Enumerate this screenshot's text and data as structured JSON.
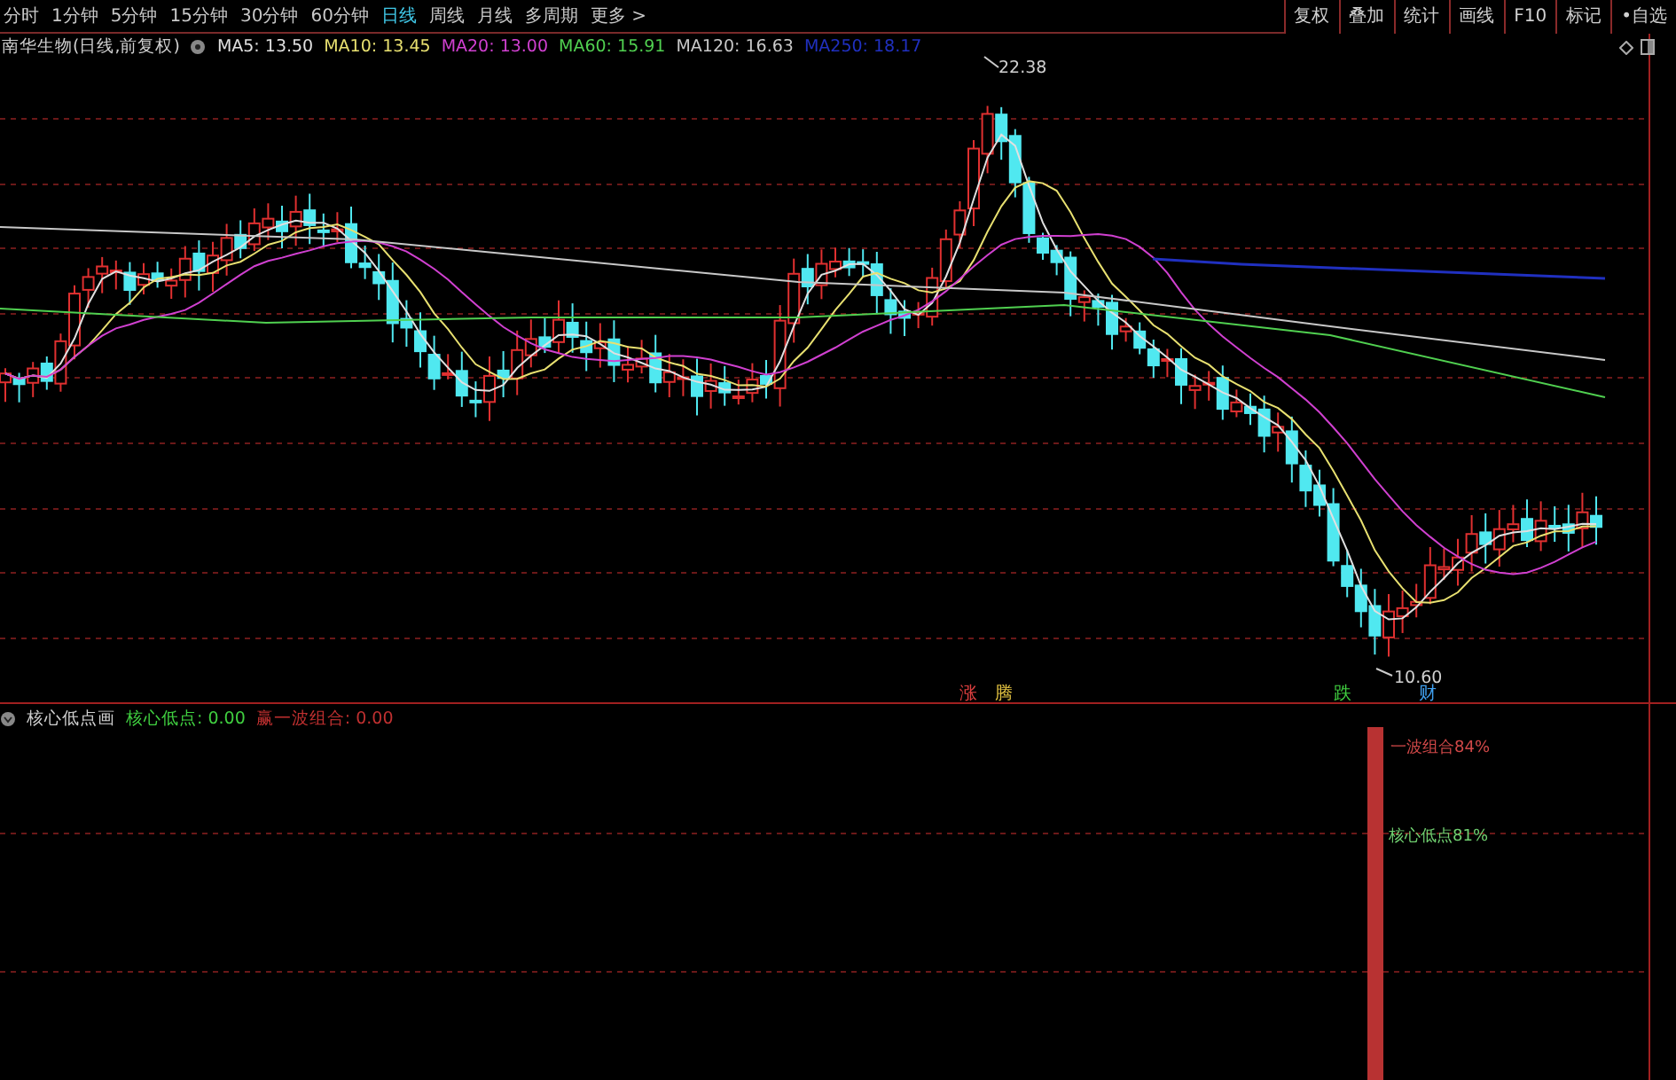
{
  "toolbar": {
    "periods": [
      {
        "label": "分时",
        "selected": false
      },
      {
        "label": "1分钟",
        "selected": false
      },
      {
        "label": "5分钟",
        "selected": false
      },
      {
        "label": "15分钟",
        "selected": false
      },
      {
        "label": "30分钟",
        "selected": false
      },
      {
        "label": "60分钟",
        "selected": false
      },
      {
        "label": "日线",
        "selected": true
      },
      {
        "label": "周线",
        "selected": false
      },
      {
        "label": "月线",
        "selected": false
      },
      {
        "label": "多周期",
        "selected": false
      },
      {
        "label": "更多 >",
        "selected": false
      }
    ],
    "buttons": [
      "复权",
      "叠加",
      "统计",
      "画线",
      "F10",
      "标记",
      "•自选"
    ]
  },
  "main_chart": {
    "title": "南华生物(日线,前复权)",
    "legend": [
      {
        "label": "MA5: 13.50",
        "color": "#e0e0e0"
      },
      {
        "label": "MA10: 13.45",
        "color": "#e8e070"
      },
      {
        "label": "MA20: 13.00",
        "color": "#d040d0"
      },
      {
        "label": "MA60: 15.91",
        "color": "#50d050"
      },
      {
        "label": "MA120: 16.63",
        "color": "#c8c8c8"
      },
      {
        "label": "MA250: 18.17",
        "color": "#2030c0"
      }
    ],
    "high_label": "22.38",
    "low_label": "10.60",
    "signals": [
      {
        "label": "涨",
        "color": "#e04040"
      },
      {
        "label": "腾",
        "color": "#e0c040"
      },
      {
        "label": "跌",
        "color": "#40d040"
      },
      {
        "label": "财",
        "color": "#40a0f0"
      }
    ]
  },
  "indicator": {
    "name": "核心低点画",
    "values": [
      {
        "label": "核心低点: 0.00",
        "color": "#40d040"
      },
      {
        "label": "赢一波组合: 0.00",
        "color": "#c03030"
      }
    ],
    "bar_labels": [
      {
        "label": "一波组合84%",
        "color": "#d04848"
      },
      {
        "label": "核心低点81%",
        "color": "#70d070"
      }
    ]
  }
}
